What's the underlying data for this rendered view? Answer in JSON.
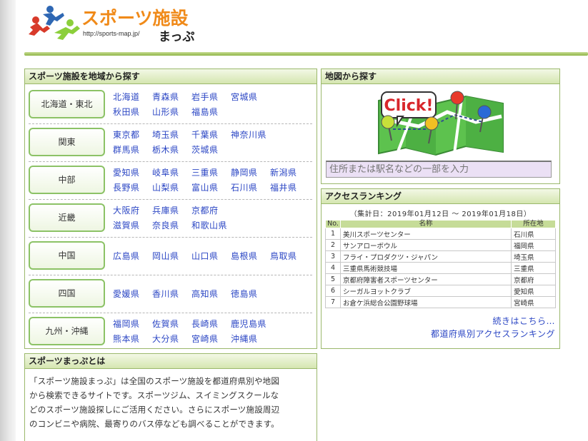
{
  "header": {
    "logo_title": "スポーツ施設",
    "logo_sub": "まっぷ",
    "logo_url": "http://sports-map.jp/"
  },
  "regions": {
    "title": "スポーツ施設を地域から探す",
    "groups": [
      {
        "name": "北海道・東北",
        "prefs": [
          [
            "北海道",
            "青森県",
            "岩手県",
            "宮城県"
          ],
          [
            "秋田県",
            "山形県",
            "福島県"
          ]
        ]
      },
      {
        "name": "関東",
        "prefs": [
          [
            "東京都",
            "埼玉県",
            "千葉県",
            "神奈川県"
          ],
          [
            "群馬県",
            "栃木県",
            "茨城県"
          ]
        ]
      },
      {
        "name": "中部",
        "prefs": [
          [
            "愛知県",
            "岐阜県",
            "三重県",
            "静岡県",
            "新潟県"
          ],
          [
            "長野県",
            "山梨県",
            "富山県",
            "石川県",
            "福井県"
          ]
        ]
      },
      {
        "name": "近畿",
        "prefs": [
          [
            "大阪府",
            "兵庫県",
            "京都府"
          ],
          [
            "滋賀県",
            "奈良県",
            "和歌山県"
          ]
        ]
      },
      {
        "name": "中国",
        "prefs": [
          [
            "広島県",
            "岡山県",
            "山口県",
            "島根県",
            "鳥取県"
          ]
        ]
      },
      {
        "name": "四国",
        "prefs": [
          [
            "愛媛県",
            "香川県",
            "高知県",
            "徳島県"
          ]
        ]
      },
      {
        "name": "九州・沖縄",
        "prefs": [
          [
            "福岡県",
            "佐賀県",
            "長崎県",
            "鹿児島県"
          ],
          [
            "熊本県",
            "大分県",
            "宮崎県",
            "沖縄県"
          ]
        ]
      }
    ]
  },
  "map": {
    "title": "地図から探す",
    "click_label": "Click!",
    "search_placeholder": "住所または駅名などの一部を入力"
  },
  "ranking": {
    "title": "アクセスランキング",
    "period": "（集計日：2019年01月12日 ～ 2019年01月18日）",
    "columns": [
      "No.",
      "名称",
      "所在地"
    ],
    "rows": [
      [
        "1",
        "美川スポーツセンター",
        "石川県"
      ],
      [
        "2",
        "サンアローボウル",
        "福岡県"
      ],
      [
        "3",
        "フライ・プロダクツ・ジャパン",
        "埼玉県"
      ],
      [
        "4",
        "三重県馬術競技場",
        "三重県"
      ],
      [
        "5",
        "京都府障害者スポーツセンター",
        "京都府"
      ],
      [
        "6",
        "シーガルヨットクラブ",
        "愛知県"
      ],
      [
        "7",
        "お倉ケ浜総合公園野球場",
        "宮崎県"
      ]
    ],
    "more_link": "続きはこちら…",
    "pref_link": "都道府県別アクセスランキング"
  },
  "about": {
    "title": "スポーツまっぷとは",
    "lines": [
      "「スポーツ施設まっぷ」は全国のスポーツ施設を都道府県別や地図",
      "から検索できるサイトです。スポーツジム、スイミングスクールな",
      "どのスポーツ施設探しにご活用ください。さらにスポーツ施設周辺",
      "のコンビニや病院、最寄りのバス停なども調べることができます。"
    ]
  }
}
